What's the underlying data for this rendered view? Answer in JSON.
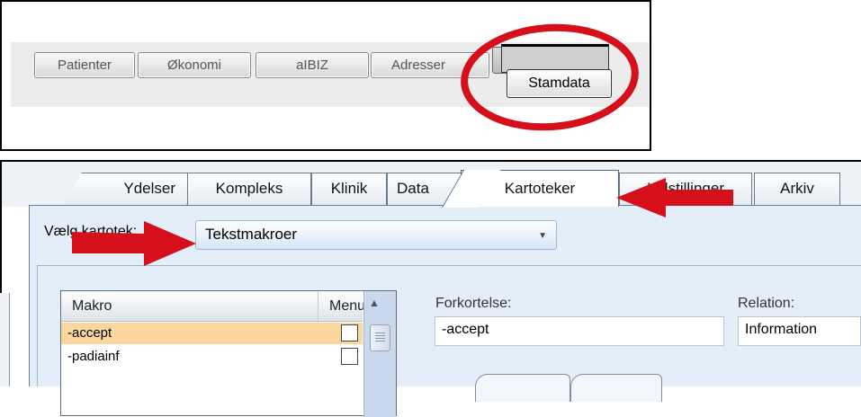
{
  "top_toolbar": {
    "buttons": [
      {
        "label": "Patienter"
      },
      {
        "label": "Økonomi"
      },
      {
        "label": "aIBIZ"
      },
      {
        "label": "Adresser"
      }
    ],
    "highlighted_button": {
      "label": "Stamdata"
    }
  },
  "tabs": [
    {
      "label": "Ydelser"
    },
    {
      "label": "Kompleks"
    },
    {
      "label": "Klinik"
    },
    {
      "label": "Data"
    },
    {
      "label": "Kartoteker",
      "active": true
    },
    {
      "label": "Indstillinger"
    },
    {
      "label": "Arkiv"
    }
  ],
  "selector": {
    "label": "Vælg kartotek:",
    "value": "Tekstmakroer"
  },
  "grid": {
    "columns": [
      "Makro",
      "Menu"
    ],
    "rows": [
      {
        "name": "-accept",
        "menu": false,
        "selected": true
      },
      {
        "name": "-padiainf",
        "menu": false,
        "selected": false
      }
    ]
  },
  "form": {
    "forkortelse_label": "Forkortelse:",
    "forkortelse_value": "-accept",
    "relation_label": "Relation:",
    "relation_value": "Information"
  },
  "colors": {
    "annotation_red": "#d6101a",
    "selected_row": "#fbd69e",
    "panel_blue": "#e4eef9"
  }
}
